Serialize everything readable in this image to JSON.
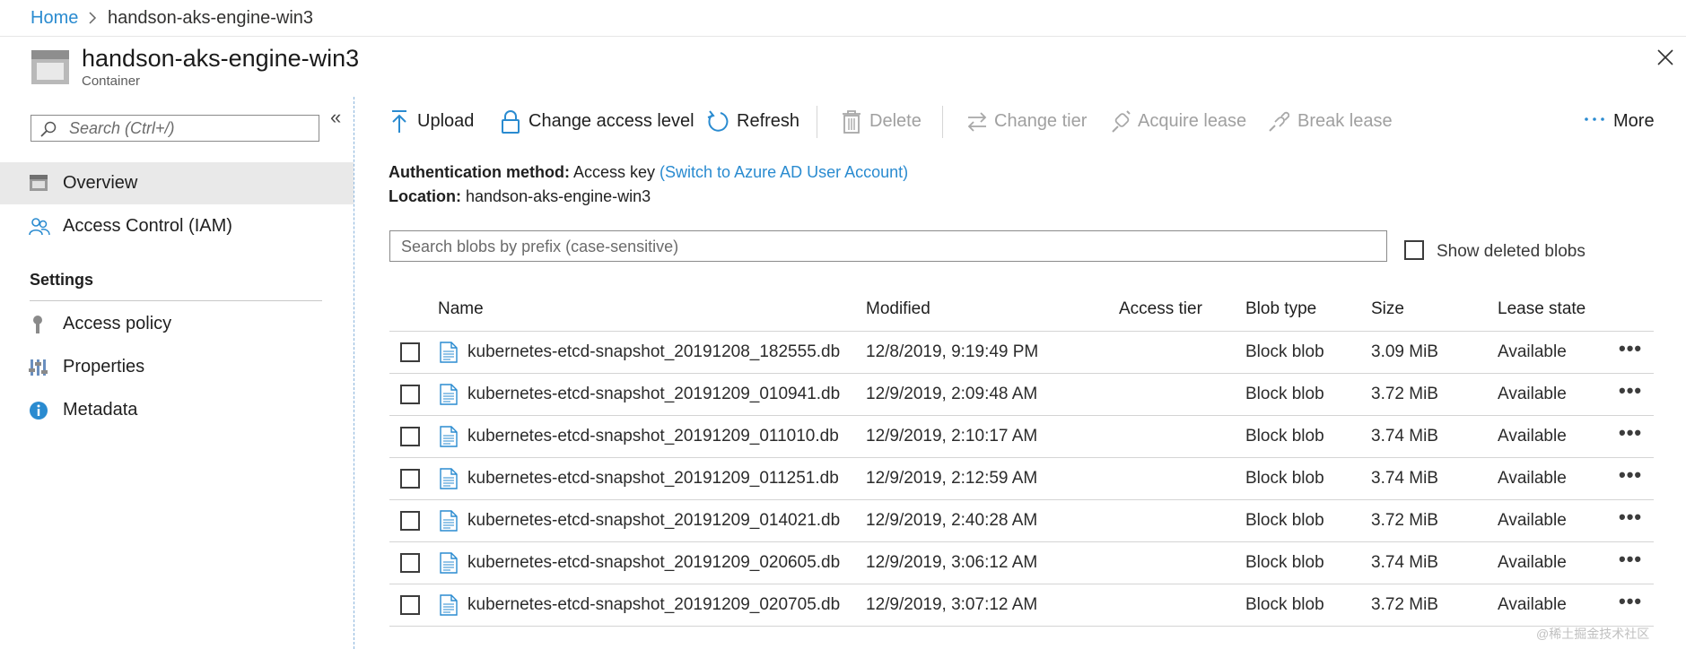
{
  "breadcrumb": {
    "home": "Home",
    "current": "handson-aks-engine-win3"
  },
  "header": {
    "title": "handson-aks-engine-win3",
    "subtitle": "Container",
    "icon": "container-icon"
  },
  "sidebar": {
    "search_placeholder": "Search (Ctrl+/)",
    "items": [
      {
        "label": "Overview",
        "icon": "overview-icon",
        "selected": true
      },
      {
        "label": "Access Control (IAM)",
        "icon": "people-icon"
      }
    ],
    "settings_heading": "Settings",
    "settings_items": [
      {
        "label": "Access policy",
        "icon": "key-icon"
      },
      {
        "label": "Properties",
        "icon": "sliders-icon"
      },
      {
        "label": "Metadata",
        "icon": "info-icon"
      }
    ]
  },
  "toolbar": {
    "upload": "Upload",
    "change_access": "Change access level",
    "refresh": "Refresh",
    "delete": "Delete",
    "change_tier": "Change tier",
    "acquire_lease": "Acquire lease",
    "break_lease": "Break lease",
    "more": "More"
  },
  "info": {
    "auth_label": "Authentication method:",
    "auth_value": "Access key",
    "auth_link": "(Switch to Azure AD User Account)",
    "location_label": "Location:",
    "location_value": "handson-aks-engine-win3"
  },
  "blob_search": {
    "placeholder": "Search blobs by prefix (case-sensitive)"
  },
  "show_deleted": {
    "label": "Show deleted blobs",
    "checked": false
  },
  "table": {
    "columns": [
      "Name",
      "Modified",
      "Access tier",
      "Blob type",
      "Size",
      "Lease state"
    ],
    "rows": [
      {
        "name": "kubernetes-etcd-snapshot_20191208_182555.db",
        "modified": "12/8/2019, 9:19:49 PM",
        "tier": "",
        "type": "Block blob",
        "size": "3.09 MiB",
        "lease": "Available"
      },
      {
        "name": "kubernetes-etcd-snapshot_20191209_010941.db",
        "modified": "12/9/2019, 2:09:48 AM",
        "tier": "",
        "type": "Block blob",
        "size": "3.72 MiB",
        "lease": "Available"
      },
      {
        "name": "kubernetes-etcd-snapshot_20191209_011010.db",
        "modified": "12/9/2019, 2:10:17 AM",
        "tier": "",
        "type": "Block blob",
        "size": "3.74 MiB",
        "lease": "Available"
      },
      {
        "name": "kubernetes-etcd-snapshot_20191209_011251.db",
        "modified": "12/9/2019, 2:12:59 AM",
        "tier": "",
        "type": "Block blob",
        "size": "3.74 MiB",
        "lease": "Available"
      },
      {
        "name": "kubernetes-etcd-snapshot_20191209_014021.db",
        "modified": "12/9/2019, 2:40:28 AM",
        "tier": "",
        "type": "Block blob",
        "size": "3.72 MiB",
        "lease": "Available"
      },
      {
        "name": "kubernetes-etcd-snapshot_20191209_020605.db",
        "modified": "12/9/2019, 3:06:12 AM",
        "tier": "",
        "type": "Block blob",
        "size": "3.74 MiB",
        "lease": "Available"
      },
      {
        "name": "kubernetes-etcd-snapshot_20191209_020705.db",
        "modified": "12/9/2019, 3:07:12 AM",
        "tier": "",
        "type": "Block blob",
        "size": "3.72 MiB",
        "lease": "Available"
      }
    ],
    "row_menu": "•••"
  },
  "watermark": "@稀土掘金技术社区",
  "colors": {
    "link": "#2a8bd0",
    "accent": "#0078d4",
    "selected_bg": "#e9e9e9"
  }
}
